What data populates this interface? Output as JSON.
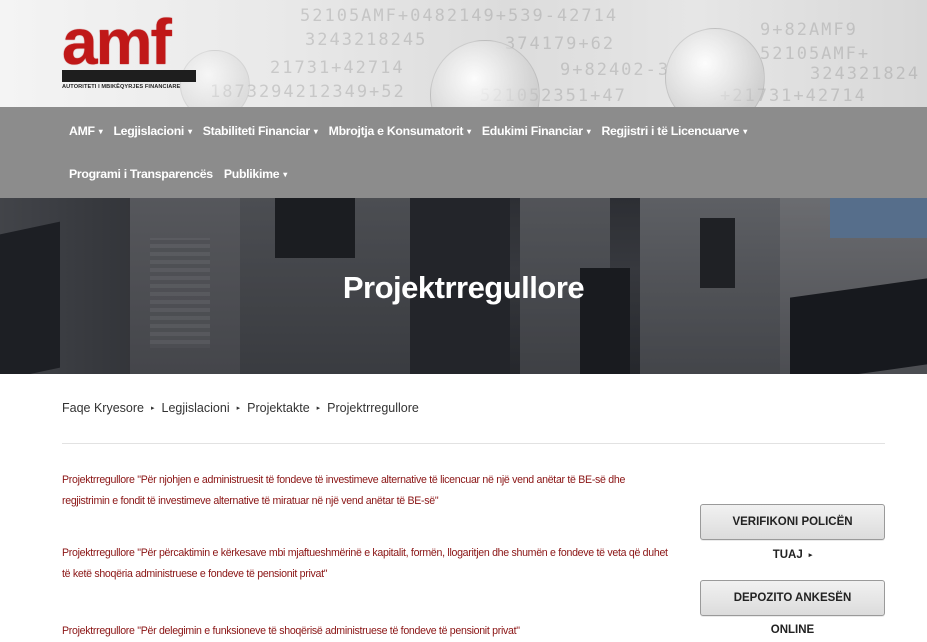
{
  "header": {
    "logo_text": "amf",
    "logo_subtitle": "AUTORITETI I MBIKËQYRJES FINANCIARE",
    "bg_numbers": [
      "52105AMF+0482149+539-42714",
      "3243218245",
      "21731+42714",
      "1873294212349+52",
      "9+82AMF9",
      "52105AMF+",
      "324321824",
      "9+82402-3",
      "+21731+42714",
      "374179+62",
      "521052351+47"
    ]
  },
  "nav": {
    "row1": [
      {
        "label": "AMF",
        "dropdown": true
      },
      {
        "label": "Legjislacioni",
        "dropdown": true
      },
      {
        "label": "Stabiliteti Financiar",
        "dropdown": true
      },
      {
        "label": "Mbrojtja e Konsumatorit",
        "dropdown": true
      },
      {
        "label": "Edukimi Financiar",
        "dropdown": true
      },
      {
        "label": "Regjistri i të Licencuarve",
        "dropdown": true
      }
    ],
    "row2": [
      {
        "label": "Programi i Transparencës",
        "dropdown": false
      },
      {
        "label": "Publikime",
        "dropdown": true
      }
    ],
    "caret_glyph": "▾"
  },
  "hero": {
    "title": "Projektrregullore"
  },
  "breadcrumb": {
    "items": [
      "Faqe Kryesore",
      "Legjislacioni",
      "Projektakte",
      "Projektrregullore"
    ],
    "separator": "▸"
  },
  "documents": [
    "Projektrregullore \"Për njohjen e administruesit të fondeve të investimeve alternative të licencuar në një vend anëtar të BE-së dhe regjistrimin e fondit të investimeve alternative të miratuar në një vend anëtar të BE-së\"",
    "Projektrregullore \"Për përcaktimin e kërkesave mbi mjaftueshmërinë e kapitalit, formën, llogaritjen dhe shumën e fondeve të veta që duhet të ketë shoqëria administruese e fondeve të pensionit privat\"",
    "Projektrregullore \"Për delegimin e funksioneve të shoqërisë administruese të fondeve të pensionit privat\""
  ],
  "sidebar": {
    "verify_button": "VERIFIKONI POLICËN",
    "verify_sub": "TUAJ",
    "complaint_button": "DEPOZITO ANKESËN",
    "complaint_sub": "ONLINE",
    "arrow_glyph": "▸"
  },
  "colors": {
    "brand_red": "#c01818",
    "nav_bg": "#8c8c8c",
    "link_red": "#8a1414"
  }
}
